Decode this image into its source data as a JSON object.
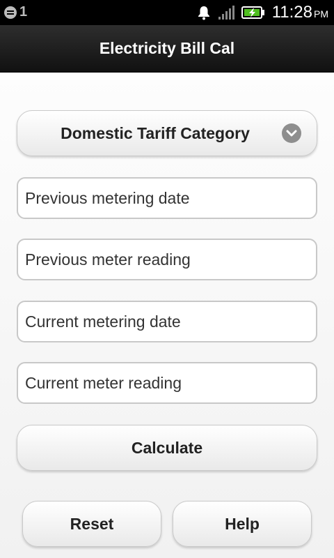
{
  "status_bar": {
    "notification_count": "1",
    "time": "11:28",
    "ampm": "PM"
  },
  "app": {
    "title": "Electricity Bill Cal"
  },
  "form": {
    "tariff_category": "Domestic Tariff Category",
    "previous_metering_date_placeholder": "Previous metering date",
    "previous_meter_reading_placeholder": "Previous meter reading",
    "current_metering_date_placeholder": "Current metering date",
    "current_meter_reading_placeholder": "Current meter reading",
    "calculate_label": "Calculate",
    "reset_label": "Reset",
    "help_label": "Help"
  },
  "colors": {
    "titlebar": "#1e1e1e",
    "battery": "#4fbe1f",
    "chevron": "#8e8e8e"
  }
}
